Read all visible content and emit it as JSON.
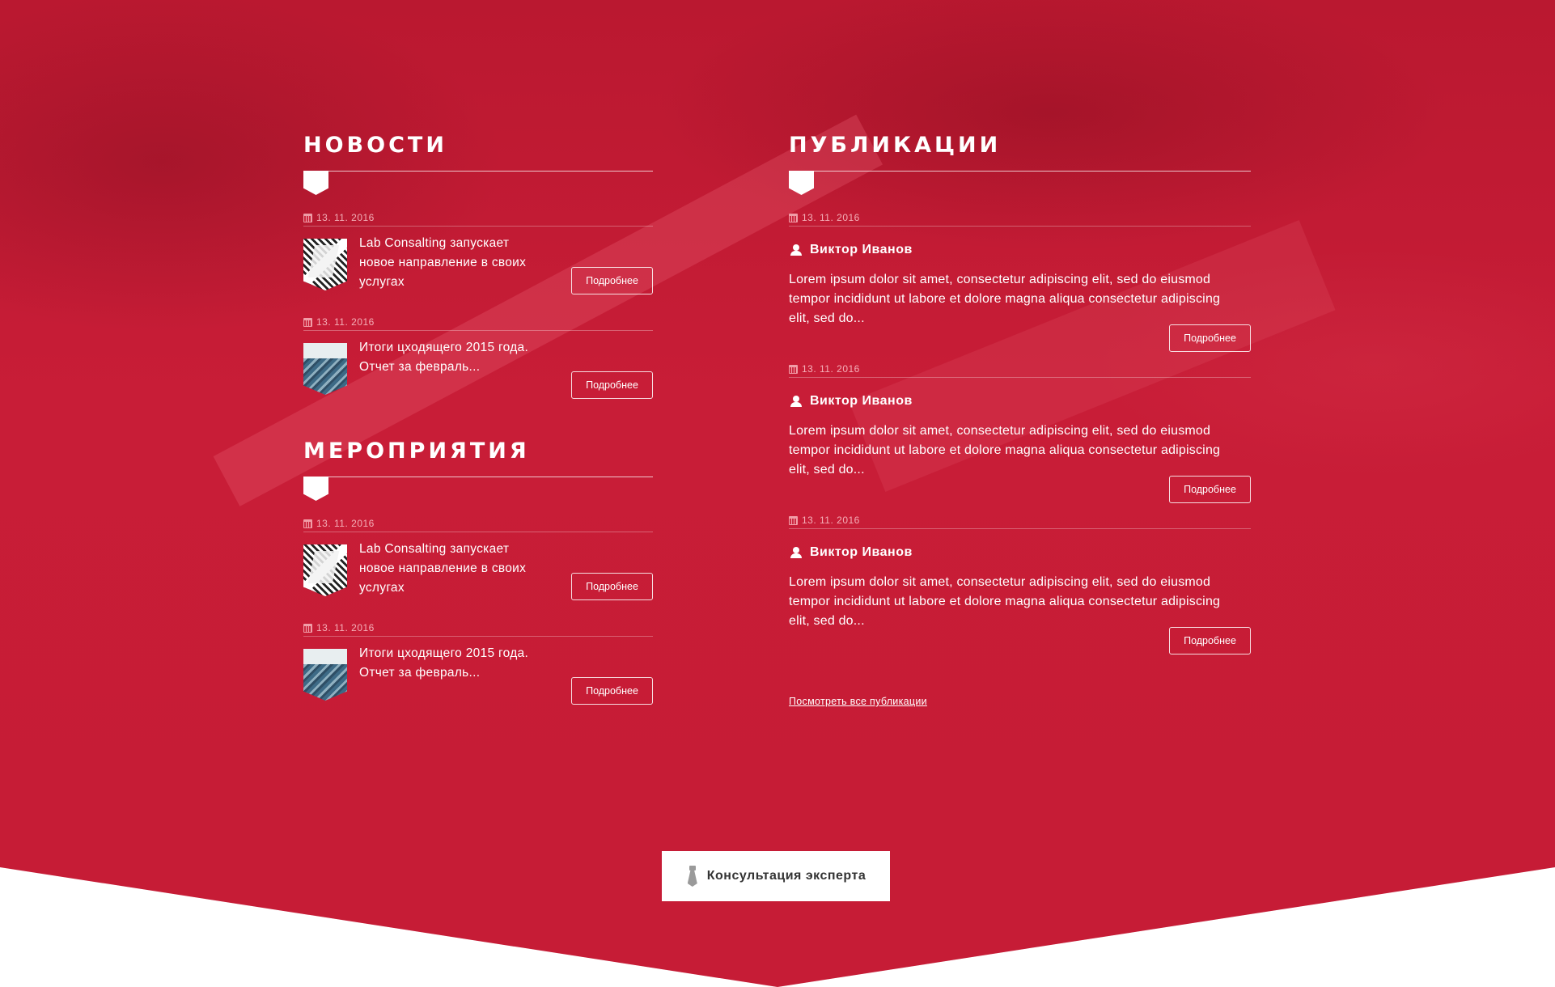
{
  "news": {
    "title": "НОВОСТИ",
    "items": [
      {
        "date": "13. 11. 2016",
        "text": "Lab Consalting запускает новое направление в своих услугах",
        "button": "Подробнее"
      },
      {
        "date": "13. 11. 2016",
        "text": "Итоги цходящего 2015 года. Отчет за февраль...",
        "button": "Подробнее"
      }
    ]
  },
  "events": {
    "title": "МЕРОПРИЯТИЯ",
    "items": [
      {
        "date": "13. 11. 2016",
        "text": "Lab Consalting запускает новое направление в своих услугах",
        "button": "Подробнее"
      },
      {
        "date": "13. 11. 2016",
        "text": "Итоги цходящего 2015 года. Отчет за февраль...",
        "button": "Подробнее"
      }
    ]
  },
  "publications": {
    "title": "ПУБЛИКАЦИИ",
    "items": [
      {
        "date": "13. 11. 2016",
        "author": "Виктор Иванов",
        "text": "Lorem ipsum dolor sit amet, consectetur adipiscing elit, sed do eiusmod tempor incididunt ut labore et dolore magna aliqua consectetur adipiscing elit, sed do...",
        "button": "Подробнее"
      },
      {
        "date": "13. 11. 2016",
        "author": "Виктор Иванов",
        "text": "Lorem ipsum dolor sit amet, consectetur adipiscing elit, sed do eiusmod tempor incididunt ut labore et dolore magna aliqua consectetur adipiscing elit, sed do...",
        "button": "Подробнее"
      },
      {
        "date": "13. 11. 2016",
        "author": "Виктор Иванов",
        "text": "Lorem ipsum dolor sit amet, consectetur adipiscing elit, sed do eiusmod tempor incididunt ut labore et dolore magna aliqua consectetur adipiscing elit, sed do...",
        "button": "Подробнее"
      }
    ],
    "all_link": "Посмотреть все публикации"
  },
  "consult_button": "Консультация эксперта",
  "colors": {
    "background_red": "#c81d37",
    "white": "#ffffff",
    "button_text": "#333333"
  },
  "icons": {
    "date": "calendar-icon",
    "author": "user-icon",
    "consult": "tie-icon"
  }
}
